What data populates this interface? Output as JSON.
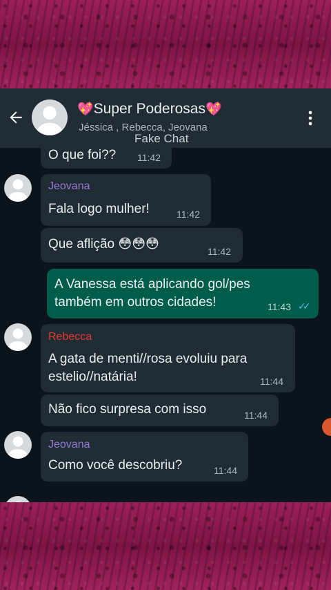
{
  "chat": {
    "title": "Super Poderosas",
    "title_emoji": "💖",
    "participants": "Jéssica , Rebecca, Jeovana",
    "watermark": "Fake Chat"
  },
  "messages": [
    {
      "text": "O que foi??",
      "time": "11:42"
    },
    {
      "sender": "Jeovana",
      "text": "Fala logo mulher!",
      "time": "11:42"
    },
    {
      "text": "Que aflição",
      "emoji": "😳😳😳",
      "time": "11:42"
    },
    {
      "text_line1": "A Vanessa está aplicando gol/pes",
      "text_line2": "também em outros cidades!",
      "time": "11:43",
      "status": "read"
    },
    {
      "sender": "Rebecca",
      "text_line1": "A gata de menti//rosa evoluiu para",
      "text_line2": "estelio//natária!",
      "time": "11:44"
    },
    {
      "text": "Não fico surpresa com isso",
      "time": "11:44"
    },
    {
      "sender": "Jeovana",
      "text": "Como você descobriu?",
      "time": "11:44"
    }
  ],
  "colors": {
    "background_frame": "#8a1a4e",
    "chat_bg": "#0b141a",
    "incoming_bubble": "#1f2c34",
    "outgoing_bubble": "#005c4b",
    "sender_jeovana": "#9a7ad6",
    "sender_rebecca": "#e53935",
    "read_ticks": "#53bdeb"
  },
  "icons": {
    "back": "arrow-left-icon",
    "menu": "more-vert-icon",
    "avatar": "default-avatar-icon",
    "status": "double-check-icon"
  }
}
